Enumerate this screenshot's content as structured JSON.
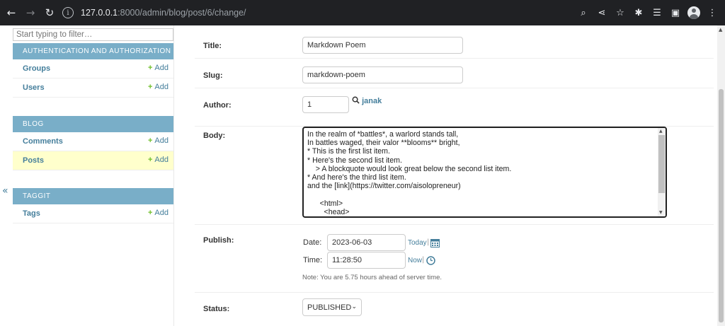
{
  "browser": {
    "url_host": "127.0.0.1",
    "url_rest": ":8000/admin/blog/post/6/change/"
  },
  "sidebar": {
    "filter_placeholder": "Start typing to filter…",
    "modules": [
      {
        "title": "AUTHENTICATION AND AUTHORIZATION",
        "rows": [
          {
            "name": "Groups",
            "add": "Add"
          },
          {
            "name": "Users",
            "add": "Add"
          }
        ]
      },
      {
        "title": "BLOG",
        "rows": [
          {
            "name": "Comments",
            "add": "Add"
          },
          {
            "name": "Posts",
            "add": "Add"
          }
        ]
      },
      {
        "title": "TAGGIT",
        "rows": [
          {
            "name": "Tags",
            "add": "Add"
          }
        ]
      }
    ],
    "toggle": "«"
  },
  "form": {
    "title_label": "Title:",
    "title_value": "Markdown Poem",
    "slug_label": "Slug:",
    "slug_value": "markdown-poem",
    "author_label": "Author:",
    "author_value": "1",
    "author_lookup": "janak",
    "body_label": "Body:",
    "body_value": "In the realm of *battles*, a warlord stands tall,\nIn battles waged, their valor **blooms** bright,\n* This is the first list item.\n* Here's the second list item.\n    > A blockquote would look great below the second list item.\n* And here's the third list item.\nand the [link](https://twitter.com/aisolopreneur)\n\n      <html>\n        <head>\n          <title>Test</title>",
    "publish_label": "Publish:",
    "date_label": "Date:",
    "date_value": "2023-06-03",
    "today_link": "Today",
    "time_label": "Time:",
    "time_value": "11:28:50",
    "now_link": "Now",
    "note": "Note: You are 5.75 hours ahead of server time.",
    "status_label": "Status:",
    "status_value": "PUBLISHED"
  }
}
